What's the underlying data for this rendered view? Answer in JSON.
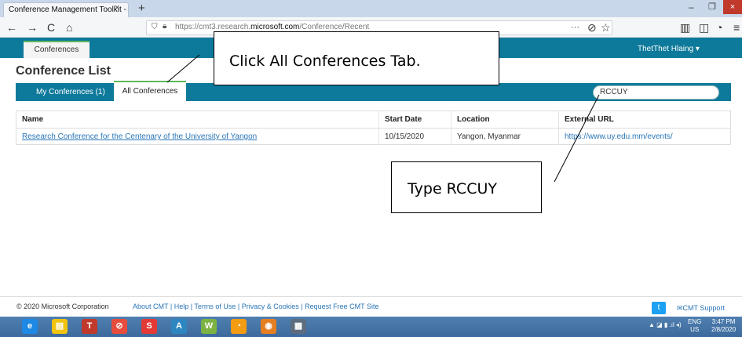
{
  "browser": {
    "tab_title": "Conference Management Toolkit - ",
    "tab_close": "×",
    "new_tab": "+",
    "url_prefix": "https://cmt3.research.",
    "url_domain": "microsoft.com",
    "url_path": "/Conference/Recent",
    "minimize": "–",
    "maximize": "❐",
    "close": "×",
    "back": "←",
    "forward": "→",
    "reload": "C",
    "home": "⌂",
    "menu_dots": "···",
    "pocket": "⊘",
    "star": "☆",
    "library": "▥",
    "sidebar": "◫",
    "extension": "◔",
    "hamburger": "≡"
  },
  "app": {
    "top_tab": "Conferences",
    "user_name": "ThetThet Hlaing ▾",
    "page_title": "Conference List",
    "sub_tabs": [
      "My Conferences (1)",
      "All Conferences"
    ],
    "search_value": "RCCUY"
  },
  "table": {
    "headers": [
      "Name",
      "Start Date",
      "Location",
      "External URL"
    ],
    "rows": [
      {
        "name": "Research Conference for the Centenary of the University of Yangon",
        "start_date": "10/15/2020",
        "location": "Yangon, Myanmar",
        "url": "https://www.uy.edu.mm/events/"
      }
    ]
  },
  "annotations": {
    "callout_1": "Click All Conferences Tab.",
    "callout_2": "Type RCCUY"
  },
  "footer": {
    "copyright": "© 2020 Microsoft Corporation",
    "links": "About CMT | Help | Terms of Use | Privacy & Cookies | Request Free CMT Site",
    "support": "✉CMT Support"
  },
  "taskbar": {
    "icons": [
      "e",
      "▤",
      "T",
      "⊘",
      "S",
      "A",
      "W",
      "◔",
      "◉",
      "▦"
    ],
    "icon_colors": [
      "#1e88e5",
      "#f1c40f",
      "#c0392b",
      "#e74c3c",
      "#e53935",
      "#2e86c1",
      "#7cb342",
      "#f39c12",
      "#e67e22",
      "#5d6d7e"
    ],
    "tray": "▲ ◪ ▮ .ıl ◂)",
    "lang": "ENG",
    "region": "US",
    "time": "3:47 PM",
    "date": "2/8/2020"
  }
}
